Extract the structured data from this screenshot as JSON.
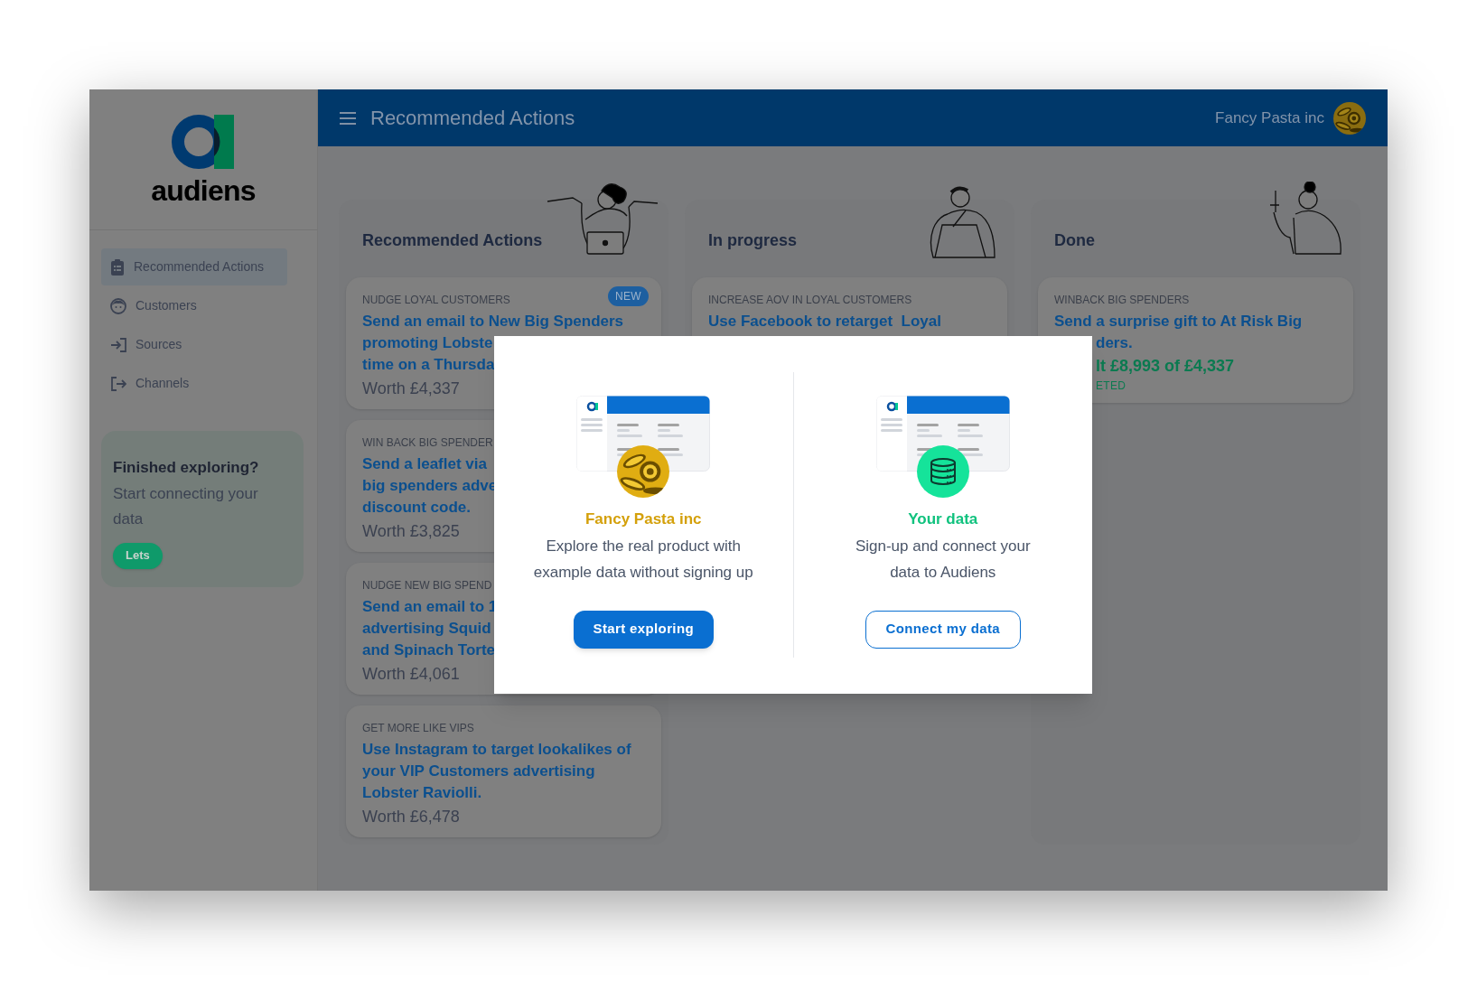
{
  "sidebar": {
    "logo_text": "audiens",
    "nav": [
      {
        "label": "Recommended Actions",
        "selected": true
      },
      {
        "label": "Customers",
        "selected": false
      },
      {
        "label": "Sources",
        "selected": false
      },
      {
        "label": "Channels",
        "selected": false
      }
    ],
    "promo": {
      "title": "Finished exploring?",
      "text": "Start connecting your data",
      "button": "Lets"
    }
  },
  "header": {
    "title": "Recommended Actions",
    "account": "Fancy Pasta inc"
  },
  "columns": [
    {
      "title": "Recommended Actions",
      "cards": [
        {
          "category": "NUDGE LOYAL CUSTOMERS",
          "badge": "NEW",
          "title_lines": [
            "Send an email to New Big Spenders",
            "promoting Lobste",
            "time on a Thursda"
          ],
          "worth": "Worth £4,337"
        },
        {
          "category": "WIN BACK BIG SPENDER",
          "title_lines": [
            "Send a leaflet via",
            "big spenders adve",
            "discount code."
          ],
          "worth": "Worth £3,825"
        },
        {
          "category": "NUDGE NEW BIG SPEND",
          "title_lines": [
            "Send an email to 1",
            "advertising Squid",
            "and Spinach Torte"
          ],
          "worth": "Worth £4,061"
        },
        {
          "category": "GET MORE LIKE VIPS",
          "title_lines": [
            "Use Instagram to target lookalikes of",
            "your VIP Customers advertising",
            "Lobster Raviolli."
          ],
          "worth": "Worth £6,478"
        }
      ]
    },
    {
      "title": "In progress",
      "cards": [
        {
          "category": "INCREASE AOV IN LOYAL CUSTOMERS",
          "title_lines": [
            "Use Facebook to retarget  Loyal"
          ]
        }
      ]
    },
    {
      "title": "Done",
      "cards": [
        {
          "category": "WINBACK BIG SPENDERS",
          "cut_left": true,
          "title_lines": [
            "Send a surprise gift to At Risk Big",
            "ders."
          ],
          "result": "lt £8,993 of £4,337",
          "status": "ETED"
        }
      ]
    }
  ],
  "modal": {
    "options": [
      {
        "kind": "demo",
        "name": "Fancy Pasta inc",
        "text": "Explore the real product with example data without signing up",
        "button": "Start exploring"
      },
      {
        "kind": "own",
        "name": "Your data",
        "text": "Sign-up and connect your data to Audiens",
        "button": "Connect my data"
      }
    ]
  }
}
